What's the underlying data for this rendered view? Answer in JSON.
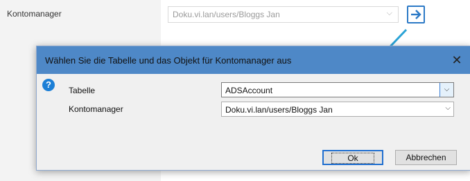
{
  "background": {
    "label": "Kontomanager",
    "combo_value": "Doku.vi.lan/users/Bloggs Jan",
    "combo_chevron": "⌵",
    "nav_icon": "arrow-right-icon"
  },
  "dialog": {
    "title": "Wählen Sie die Tabelle und das Objekt für Kontomanager aus",
    "close": "✕",
    "help": "?",
    "rows": [
      {
        "label": "Tabelle",
        "value": "ADSAccount"
      },
      {
        "label": "Kontomanager",
        "value": "Doku.vi.lan/users/Bloggs Jan"
      }
    ],
    "ok_label": "Ok",
    "cancel_label": "Abbrechen",
    "dropdown_chevron": "⌵"
  },
  "colors": {
    "titlebar": "#4e88c7",
    "accent": "#2b79c6",
    "callout_arrow": "#2aa3d6"
  }
}
